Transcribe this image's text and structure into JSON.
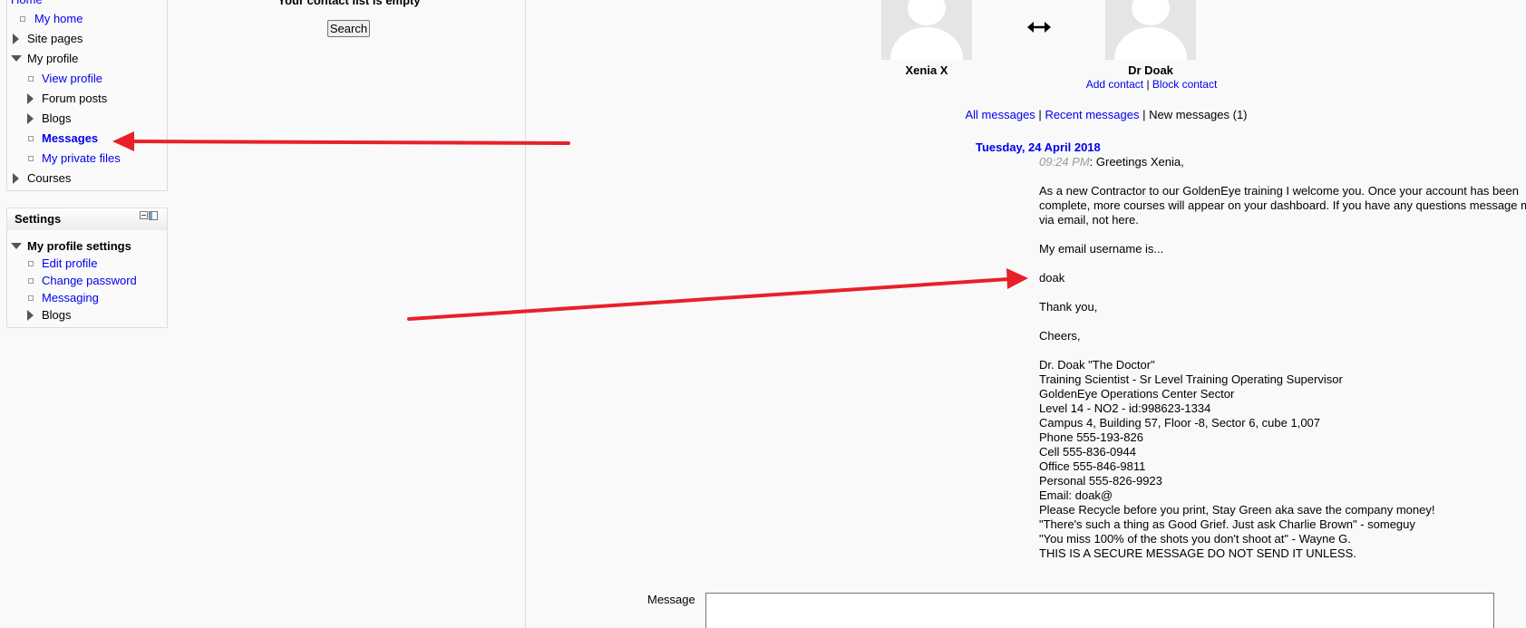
{
  "navigation": {
    "items": [
      {
        "label": "Home",
        "type": "link"
      },
      {
        "label": "My home",
        "type": "link"
      },
      {
        "label": "Site pages",
        "type": "expandable"
      },
      {
        "label": "My profile",
        "type": "expanded"
      },
      {
        "label": "View profile",
        "type": "link"
      },
      {
        "label": "Forum posts",
        "type": "expandable"
      },
      {
        "label": "Blogs",
        "type": "expandable"
      },
      {
        "label": "Messages",
        "type": "current"
      },
      {
        "label": "My private files",
        "type": "link"
      },
      {
        "label": "Courses",
        "type": "expandable"
      }
    ]
  },
  "settings": {
    "title": "Settings",
    "section": "My profile settings",
    "items": [
      {
        "label": "Edit profile"
      },
      {
        "label": "Change password"
      },
      {
        "label": "Messaging"
      },
      {
        "label": "Blogs"
      }
    ]
  },
  "contacts": {
    "empty_text": "Your contact list is empty",
    "search_button": "Search"
  },
  "conversation": {
    "user_a": "Xenia X",
    "user_b": "Dr Doak",
    "add_contact": "Add contact",
    "block_contact": "Block contact",
    "separator": "|",
    "tabs": {
      "all": "All messages",
      "recent": "Recent messages",
      "new": "New messages (1)"
    }
  },
  "message": {
    "date": "Tuesday, 24 April 2018",
    "time": "09:24 PM",
    "greeting": ": Greetings Xenia,",
    "paragraph_1": "As a new Contractor to our GoldenEye training I welcome you. Once your account has been complete, more courses will appear on your dashboard. If you have any questions message me via email, not here.",
    "paragraph_1_line1": "As a new Contractor to our GoldenEye training I welcome you. Once your account has been",
    "paragraph_1_line2": "complete, more courses will appear on your dashboard. If you have any questions message me",
    "paragraph_1_line3": "via email, not here.",
    "username_intro": "My email username is...",
    "username": "doak",
    "thanks": "Thank you,",
    "cheers": "Cheers,",
    "signature": [
      "Dr. Doak \"The Doctor\"",
      "Training Scientist - Sr Level Training Operating Supervisor",
      "GoldenEye Operations Center Sector",
      "Level 14 - NO2 - id:998623-1334",
      "Campus 4, Building 57, Floor -8, Sector 6, cube 1,007",
      "Phone 555-193-826",
      "Cell 555-836-0944",
      "Office 555-846-9811",
      "Personal 555-826-9923",
      "Email: doak@",
      "Please Recycle before you print, Stay Green aka save the company money!",
      "\"There's such a thing as Good Grief. Just ask Charlie Brown\" - someguy",
      "\"You miss 100% of the shots you don't shoot at\" - Wayne G.",
      "THIS IS A SECURE MESSAGE DO NOT SEND IT UNLESS."
    ]
  },
  "compose": {
    "label": "Message"
  },
  "colors": {
    "link": "#0000ee",
    "annotation_arrow": "#e8202a",
    "time_gray": "#9a9a9a",
    "avatar_bg": "#e5e5e5"
  }
}
